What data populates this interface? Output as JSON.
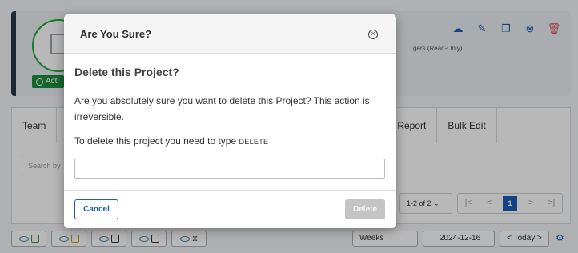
{
  "background": {
    "project_card": {
      "status": "Acti",
      "managers_text": "gers (Read-Only)"
    },
    "tabs": [
      "Team",
      "Report",
      "Bulk Edit"
    ],
    "search_placeholder": "Search by",
    "pagination": {
      "range": "1-2 of 2",
      "current_page": "1",
      "first": "|<",
      "prev": "<",
      "next": ">",
      "last": ">|"
    },
    "bottom_bar": {
      "view_select": "Weeks",
      "date": "2024-12-16",
      "today_label": "< Today >"
    }
  },
  "modal": {
    "title": "Are You Sure?",
    "heading": "Delete this Project?",
    "body_text": "Are you absolutely sure you want to delete this Project? This action is irreversible.",
    "instruction_prefix": "To delete this project you need to type",
    "instruction_keyword": "DELETE",
    "input_value": "",
    "cancel_label": "Cancel",
    "delete_label": "Delete"
  },
  "colors": {
    "primary": "#1a5fb4",
    "success": "#1e8e3e",
    "danger": "#d9534f",
    "disabled": "#c4c4c4"
  }
}
